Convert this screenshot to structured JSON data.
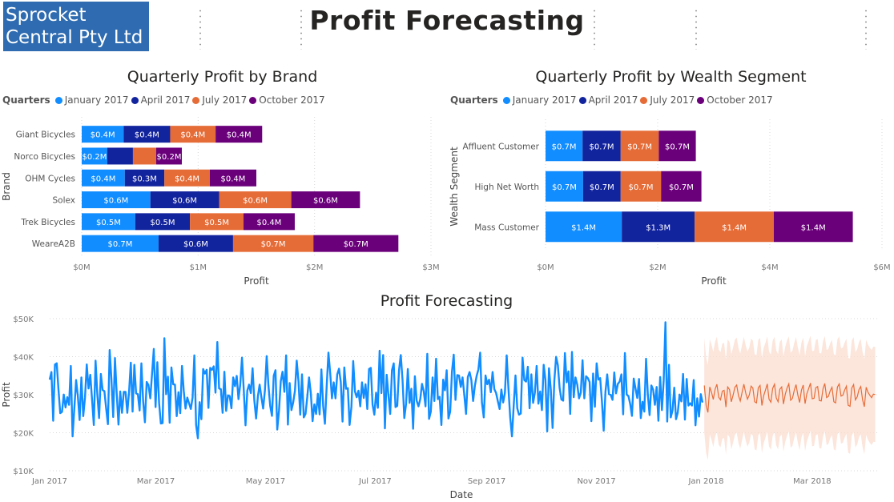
{
  "header": {
    "logo_text": "Sprocket Central Pty Ltd",
    "title": "Profit Forecasting"
  },
  "colors": {
    "q1": "#118dff",
    "q2": "#12239e",
    "q3": "#e66c37",
    "q4": "#6b007b",
    "forecast_band": "#fbdccf",
    "forecast_line": "#e66c37"
  },
  "chart_data": [
    {
      "id": "brand",
      "type": "bar",
      "orientation": "horizontal",
      "stacked": true,
      "title": "Quarterly Profit by Brand",
      "legend_title": "Quarters",
      "legend_position": "top-left",
      "categories": [
        "Giant Bicycles",
        "Norco Bicycles",
        "OHM Cycles",
        "Solex",
        "Trek Bicycles",
        "WeareA2B"
      ],
      "series": [
        {
          "name": "January 2017",
          "values": [
            0.36,
            0.22,
            0.37,
            0.59,
            0.46,
            0.66
          ],
          "labels": [
            "$0.4M",
            "$0.2M",
            "$0.4M",
            "$0.6M",
            "$0.5M",
            "$0.7M"
          ]
        },
        {
          "name": "April 2017",
          "values": [
            0.4,
            0.22,
            0.34,
            0.59,
            0.47,
            0.64
          ],
          "labels": [
            "$0.4M",
            "",
            "$0.3M",
            "$0.6M",
            "$0.5M",
            "$0.6M"
          ]
        },
        {
          "name": "July 2017",
          "values": [
            0.39,
            0.2,
            0.39,
            0.62,
            0.46,
            0.69
          ],
          "labels": [
            "$0.4M",
            "",
            "$0.4M",
            "$0.6M",
            "$0.5M",
            "$0.7M"
          ]
        },
        {
          "name": "October 2017",
          "values": [
            0.4,
            0.22,
            0.4,
            0.59,
            0.44,
            0.73
          ],
          "labels": [
            "$0.4M",
            "$0.2M",
            "$0.4M",
            "$0.6M",
            "$0.4M",
            "$0.7M"
          ]
        }
      ],
      "xlabel": "Profit",
      "ylabel": "Brand",
      "xlim": [
        0,
        3
      ],
      "xticks": [
        {
          "v": 0,
          "label": "$0M"
        },
        {
          "v": 1,
          "label": "$1M"
        },
        {
          "v": 2,
          "label": "$2M"
        },
        {
          "v": 3,
          "label": "$3M"
        }
      ],
      "grid": true
    },
    {
      "id": "wealth",
      "type": "bar",
      "orientation": "horizontal",
      "stacked": true,
      "title": "Quarterly Profit by Wealth Segment",
      "legend_title": "Quarters",
      "legend_position": "top-left",
      "categories": [
        "Affluent Customer",
        "High Net Worth",
        "Mass Customer"
      ],
      "series": [
        {
          "name": "January 2017",
          "values": [
            0.66,
            0.67,
            1.36
          ],
          "labels": [
            "$0.7M",
            "$0.7M",
            "$1.4M"
          ]
        },
        {
          "name": "April 2017",
          "values": [
            0.68,
            0.67,
            1.3
          ],
          "labels": [
            "$0.7M",
            "$0.7M",
            "$1.3M"
          ]
        },
        {
          "name": "July 2017",
          "values": [
            0.68,
            0.72,
            1.41
          ],
          "labels": [
            "$0.7M",
            "$0.7M",
            "$1.4M"
          ]
        },
        {
          "name": "October 2017",
          "values": [
            0.66,
            0.72,
            1.41
          ],
          "labels": [
            "$0.7M",
            "$0.7M",
            "$1.4M"
          ]
        }
      ],
      "xlabel": "Profit",
      "ylabel": "Wealth Segment",
      "xlim": [
        0,
        6
      ],
      "xticks": [
        {
          "v": 0,
          "label": "$0M"
        },
        {
          "v": 2,
          "label": "$2M"
        },
        {
          "v": 4,
          "label": "$4M"
        },
        {
          "v": 6,
          "label": "$6M"
        }
      ],
      "grid": true
    },
    {
      "id": "forecast",
      "type": "line",
      "title": "Profit Forecasting",
      "xlabel": "Date",
      "ylabel": "Profit",
      "ylim": [
        10000,
        50000
      ],
      "yticks": [
        {
          "v": 10000,
          "label": "$10K"
        },
        {
          "v": 20000,
          "label": "$20K"
        },
        {
          "v": 30000,
          "label": "$30K"
        },
        {
          "v": 40000,
          "label": "$40K"
        },
        {
          "v": 50000,
          "label": "$50K"
        }
      ],
      "xlim": [
        "2017-01-01",
        "2018-04-07"
      ],
      "xticks": [
        {
          "v": "2017-01-01",
          "label": "Jan 2017"
        },
        {
          "v": "2017-03-01",
          "label": "Mar 2017"
        },
        {
          "v": "2017-05-01",
          "label": "May 2017"
        },
        {
          "v": "2017-07-01",
          "label": "Jul 2017"
        },
        {
          "v": "2017-09-01",
          "label": "Sep 2017"
        },
        {
          "v": "2017-11-01",
          "label": "Nov 2017"
        },
        {
          "v": "2018-01-01",
          "label": "Jan 2018"
        },
        {
          "v": "2018-03-01",
          "label": "Mar 2018"
        }
      ],
      "actual": {
        "start": "2017-01-01",
        "end": "2017-12-30",
        "values": [
          33950,
          35950,
          23150,
          37950,
          38250,
          31350,
          25150,
          25500,
          30050,
          26650,
          29350,
          27350,
          37550,
          19050,
          26450,
          33850,
          29550,
          23350,
          34550,
          24350,
          29250,
          37950,
          31650,
          35250,
          28750,
          22050,
          38950,
          30050,
          23850,
          35450,
          31250,
          30950,
          26450,
          22250,
          41750,
          34050,
          24150,
          39650,
          30250,
          22150,
          30850,
          25250,
          30750,
          30750,
          25250,
          30750,
          38450,
          25550,
          37850,
          30350,
          30150,
          25850,
          38250,
          28250,
          22750,
          33350,
          32550,
          29050,
          35450,
          42050,
          26750,
          38550,
          27850,
          22450,
          22550,
          44850,
          30150,
          34750,
          22650,
          37150,
          32750,
          32650,
          24350,
          30650,
          25150,
          37550,
          30950,
          26350,
          29250,
          27750,
          26250,
          29250,
          40350,
          22050,
          18550,
          28050,
          23550,
          36750,
          35550,
          36550,
          26550,
          37050,
          36550,
          37450,
          30550,
          43850,
          31650,
          31450,
          25250,
          36050,
          25750,
          29850,
          29650,
          26450,
          34550,
          32250,
          34950,
          28850,
          32650,
          39750,
          31250,
          21950,
          31050,
          32650,
          30450,
          36950,
          28450,
          23750,
          29550,
          32650,
          29350,
          26350,
          31150,
          40150,
          32450,
          27050,
          24450,
          34950,
          36450,
          20850,
          25850,
          33550,
          36050,
          30750,
          40350,
          22150,
          33050,
          25950,
          27950,
          31050,
          38950,
          33550,
          24750,
          35350,
          24050,
          24950,
          29450,
          34550,
          30450,
          23050,
          27450,
          24950,
          30250,
          24850,
          36650,
          27050,
          22350,
          32250,
          41050,
          35650,
          29050,
          33250,
          29050,
          35350,
          36850,
          33350,
          22950,
          37150,
          31550,
          31750,
          22050,
          26850,
          38850,
          30850,
          29350,
          31050,
          26950,
          33250,
          29150,
          32750,
          26250,
          36750,
          37050,
          27350,
          24750,
          30550,
          26550,
          41550,
          30450,
          40450,
          21150,
          35250,
          29850,
          24950,
          36450,
          38250,
          26750,
          27050,
          36450,
          40450,
          33850,
          23850,
          27550,
          36750,
          27850,
          31550,
          21050,
          34850,
          28450,
          26950,
          28850,
          32850,
          30850,
          26950,
          40750,
          23650,
          25550,
          34550,
          28350,
          39450,
          28850,
          29450,
          22050,
          33950,
          31150,
          36450,
          23750,
          25550,
          36050,
          40550,
          28650,
          35150,
          35050,
          32050,
          34550,
          29950,
          24950,
          34650,
          35950,
          33850,
          28350,
          32350,
          34950,
          36650,
          41050,
          27950,
          24050,
          35050,
          32750,
          33950,
          30650,
          35950,
          31450,
          30450,
          28250,
          26250,
          31350,
          27950,
          30550,
          40350,
          31650,
          24050,
          19050,
          27250,
          35050,
          26450,
          24750,
          25050,
          39750,
          33850,
          33450,
          37350,
          26450,
          35350,
          27850,
          30550,
          37550,
          27650,
          30850,
          25950,
          37850,
          33850,
          20350,
          36950,
          31350,
          21250,
          33750,
          39950,
          37750,
          31750,
          28750,
          28450,
          40950,
          33250,
          36150,
          24950,
          41250,
          29350,
          34550,
          32650,
          29050,
          30550,
          39050,
          29050,
          34850,
          34350,
          33350,
          23050,
          35550,
          26850,
          38250,
          33950,
          34350,
          28250,
          20550,
          30750,
          35350,
          30150,
          29950,
          28650,
          35850,
          30350,
          32850,
          33450,
          35350,
          24850,
          40950,
          30050,
          29650,
          27550,
          24450,
          34250,
          31650,
          29150,
          34150,
          23850,
          28150,
          25550,
          39450,
          30050,
          24650,
          32450,
          31350,
          27350,
          32050,
          23150,
          34650,
          25950,
          33750,
          49050,
          22950,
          37850,
          24050,
          25850,
          31850,
          23550,
          25350,
          30050,
          28250,
          35450,
          23450,
          34150,
          27150,
          27750,
          27150,
          33850,
          21950,
          29050,
          24250,
          30150,
          27950
        ]
      },
      "forecast": {
        "start": "2017-12-31",
        "end": "2018-04-05",
        "mean": [
          32450,
          27150,
          25350,
          32050,
          30650,
          28750,
          31450,
          32750,
          29350,
          28650,
          30950,
          31150,
          26750,
          32050,
          31350,
          28150,
          29850,
          31950,
          32550,
          29750,
          28350,
          30650,
          32750,
          30450,
          28850,
          29950,
          32250,
          31750,
          28150,
          27850,
          31850,
          32450,
          27150,
          29750,
          31250,
          32850,
          28850,
          28050,
          31650,
          32750,
          29150,
          28150,
          31450,
          32050,
          27550,
          30150,
          31750,
          32850,
          28550,
          29050,
          31150,
          32650,
          29850,
          27950,
          31250,
          32550,
          27650,
          30250,
          31550,
          33050,
          28950,
          29050,
          31850,
          32150,
          28450,
          28350,
          31550,
          32950,
          29250,
          29550,
          31050,
          31950,
          28150,
          27850,
          32050,
          32850,
          29650,
          29850,
          31150,
          32250,
          27250,
          26950,
          31750,
          32650,
          28650,
          29450,
          31350,
          32150,
          28650,
          26850,
          31950,
          30650,
          29850,
          29250,
          30150,
          30050
        ],
        "upper": [
          44950,
          39650,
          37850,
          44550,
          43150,
          41250,
          43950,
          45250,
          41850,
          41150,
          43450,
          43650,
          39250,
          44550,
          43850,
          40650,
          42350,
          44450,
          45050,
          42250,
          40850,
          43150,
          45250,
          42950,
          41350,
          42450,
          44750,
          44250,
          40650,
          40350,
          44350,
          44950,
          39650,
          42250,
          43750,
          45350,
          41350,
          40550,
          44150,
          45250,
          41650,
          40650,
          43950,
          44550,
          40050,
          42650,
          44250,
          45350,
          41050,
          41550,
          43650,
          45150,
          42350,
          40450,
          43750,
          45050,
          40150,
          42750,
          44050,
          45550,
          41450,
          41550,
          44350,
          44650,
          40950,
          40850,
          44050,
          45450,
          41750,
          42050,
          43550,
          44450,
          40650,
          40350,
          44550,
          45350,
          42150,
          42350,
          43650,
          44750,
          39750,
          39450,
          44250,
          45150,
          41150,
          41950,
          43850,
          44650,
          41150,
          39350,
          44450,
          43150,
          42350,
          41750,
          42650,
          42550
        ],
        "lower": [
          19950,
          14650,
          12850,
          19550,
          18150,
          16250,
          18950,
          20250,
          16850,
          16150,
          18450,
          18650,
          14250,
          19550,
          18850,
          15650,
          17350,
          19450,
          20050,
          17250,
          15850,
          18150,
          20250,
          17950,
          16350,
          17450,
          19750,
          19250,
          15650,
          15350,
          19350,
          19950,
          14650,
          17250,
          18750,
          20350,
          16350,
          15550,
          19150,
          20250,
          16650,
          15650,
          18950,
          19550,
          15050,
          17650,
          19250,
          20350,
          16050,
          16550,
          18650,
          20150,
          17350,
          15450,
          18750,
          20050,
          15150,
          17750,
          19050,
          20550,
          16450,
          16550,
          19350,
          19650,
          15950,
          15850,
          19050,
          20450,
          16750,
          17050,
          18550,
          19450,
          15650,
          15350,
          19550,
          20350,
          17150,
          17350,
          18650,
          19750,
          14750,
          14450,
          19250,
          20150,
          16150,
          16950,
          18850,
          19650,
          16150,
          14350,
          19450,
          18150,
          17350,
          16750,
          17650,
          17550
        ]
      },
      "grid": true
    }
  ]
}
